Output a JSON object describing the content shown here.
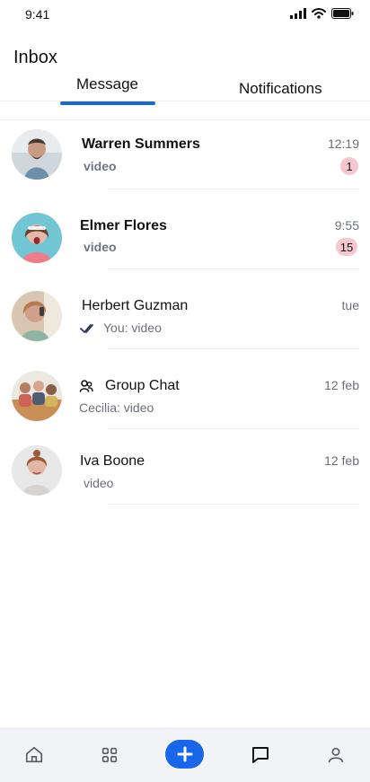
{
  "status_bar": {
    "time": "9:41",
    "icons": [
      "signal-icon",
      "wifi-icon",
      "battery-icon"
    ]
  },
  "header": {
    "title": "Inbox"
  },
  "tabs": [
    {
      "label": "Message",
      "active": true
    },
    {
      "label": "Notifications",
      "active": false
    }
  ],
  "chats": [
    {
      "name": "Warren Summers",
      "preview": "video",
      "time": "12:19",
      "badge": "1",
      "bold": true
    },
    {
      "name": "Elmer Flores",
      "preview": "video",
      "time": "9:55",
      "badge": "15",
      "bold": true
    },
    {
      "name": "Herbert Guzman",
      "preview": "You: video",
      "time": "tue",
      "badge": "",
      "bold": false
    },
    {
      "name": "Group Chat",
      "preview": "Cecilia: video",
      "time": "12 feb",
      "badge": "",
      "bold": false,
      "is_group": true
    },
    {
      "name": "Iva Boone",
      "preview": "video",
      "time": "12 feb",
      "badge": "",
      "bold": false
    }
  ],
  "bottom_nav": [
    "home-icon",
    "grid-icon",
    "plus-icon",
    "chat-icon",
    "profile-icon"
  ],
  "colors": {
    "accent": "#1767e8",
    "badge_bg": "#f7c7cf",
    "muted_text": "#6b6f78",
    "nav_bg": "#f1f3f6"
  }
}
